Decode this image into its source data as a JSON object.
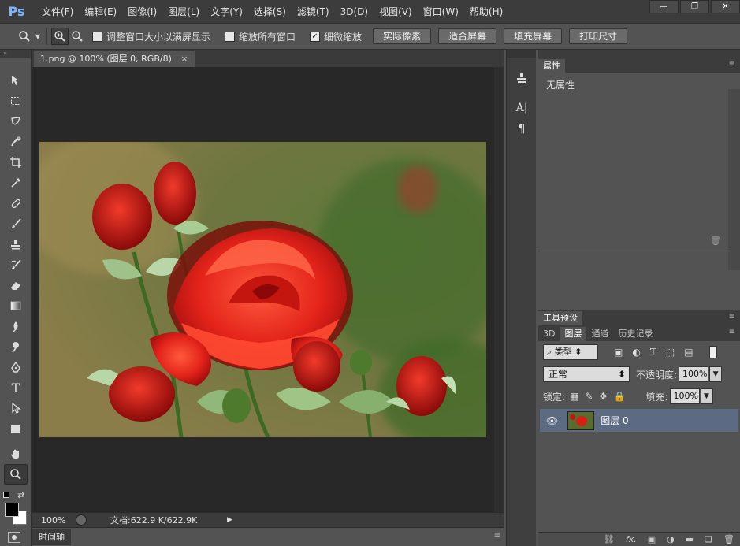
{
  "app": {
    "logo": "Ps"
  },
  "menu": [
    "文件(F)",
    "编辑(E)",
    "图像(I)",
    "图层(L)",
    "文字(Y)",
    "选择(S)",
    "滤镜(T)",
    "3D(D)",
    "视图(V)",
    "窗口(W)",
    "帮助(H)"
  ],
  "window_controls": {
    "minimize": "—",
    "restore": "❐",
    "close": "✕"
  },
  "options": {
    "resize_windows": {
      "label": "调整窗口大小以满屏显示",
      "checked": false
    },
    "zoom_all": {
      "label": "缩放所有窗口",
      "checked": false
    },
    "scrubby": {
      "label": "细微缩放",
      "checked": true
    },
    "btn_actual": "实际像素",
    "btn_fit": "适合屏幕",
    "btn_fill": "填充屏幕",
    "btn_print": "打印尺寸"
  },
  "document": {
    "tab_title": "1.png @ 100% (图层 0, RGB/8)",
    "tab_close": "×",
    "zoom": "100%",
    "doc_info": "文档:622.9 K/622.9K"
  },
  "timeline": {
    "label": "时间轴"
  },
  "properties": {
    "tab": "属性",
    "body": "无属性"
  },
  "tool_presets": {
    "tab": "工具预设"
  },
  "layers_panel": {
    "tabs": [
      "3D",
      "图层",
      "通道",
      "历史记录"
    ],
    "active_tab": "图层",
    "filter_kind": "类型",
    "blend_mode": "正常",
    "opacity_label": "不透明度:",
    "opacity": "100%",
    "lock_label": "锁定:",
    "fill_label": "填充:",
    "fill": "100%",
    "layers": [
      {
        "name": "图层 0",
        "visible": true
      }
    ]
  },
  "colors": {
    "accent": "#7ab7ff",
    "selected_layer": "#5d6b82",
    "canvas_bg": "#282828"
  },
  "icons": [
    "zoom-icon",
    "zoom-in-icon",
    "zoom-out-icon",
    "move-icon",
    "marquee-icon",
    "lasso-icon",
    "quick-select-icon",
    "crop-icon",
    "eyedropper-icon",
    "heal-icon",
    "brush-icon",
    "stamp-icon",
    "history-brush-icon",
    "eraser-icon",
    "gradient-icon",
    "blur-icon",
    "dodge-icon",
    "pen-icon",
    "type-icon",
    "path-select-icon",
    "shape-icon",
    "hand-icon",
    "zoom-tool-icon",
    "eye-icon",
    "lock-icon"
  ]
}
